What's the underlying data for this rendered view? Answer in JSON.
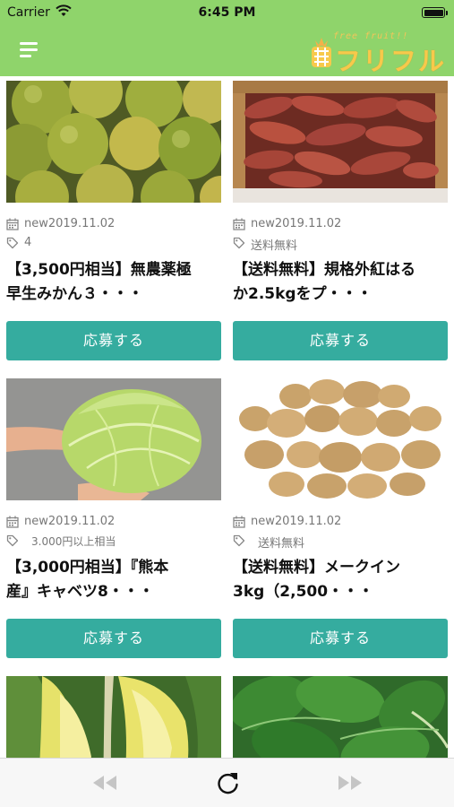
{
  "status_bar": {
    "carrier": "Carrier",
    "time": "6:45 PM"
  },
  "header": {
    "logo_top": "free fruit!!",
    "logo_main": "フリフル"
  },
  "items": [
    {
      "image": "mandarin-oranges-photo",
      "date": "new2019.11.02",
      "tag": "4",
      "title_line1": "【3,500円相当】無農薬極",
      "title_line2": "早生みかん３・・・",
      "button": "応募する"
    },
    {
      "image": "sweet-potatoes-photo",
      "date": "new2019.11.02",
      "tag": "送料無料",
      "title_line1": "【送料無料】規格外紅はる",
      "title_line2": "か2.5kgをプ・・・",
      "button": "応募する"
    },
    {
      "image": "cabbage-photo",
      "date": "new2019.11.02",
      "tag": "3.000円以上相当",
      "title_line1": "【3,000円相当】『熊本",
      "title_line2": "産』キャベツ8・・・",
      "button": "応募する"
    },
    {
      "image": "potatoes-photo",
      "date": "new2019.11.02",
      "tag": "送料無料",
      "title_line1": "【送料無料】メークイン",
      "title_line2": "3kg（2,500・・・",
      "button": "応募する"
    },
    {
      "image": "chinese-cabbage-photo"
    },
    {
      "image": "spinach-photo"
    }
  ],
  "toolbar": {
    "icons": [
      "back-icon",
      "reload-icon",
      "forward-icon"
    ]
  },
  "colors": {
    "header": "#8fd46b",
    "button": "#35ac9f",
    "logo": "#f7c94b"
  }
}
